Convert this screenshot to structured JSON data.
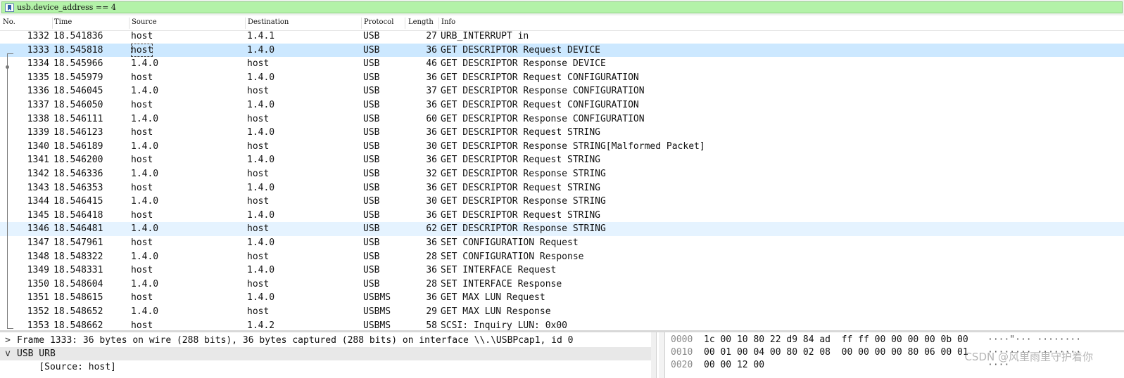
{
  "filter": {
    "text": "usb.device_address == 4",
    "accent": "#b3f2a8"
  },
  "columns": {
    "no": "No.",
    "time": "Time",
    "source": "Source",
    "destination": "Destination",
    "protocol": "Protocol",
    "length": "Length",
    "info": "Info"
  },
  "packets": [
    {
      "no": "1332",
      "time": "18.541836",
      "src": "host",
      "dst": "1.4.1",
      "proto": "USB",
      "len": "27",
      "info": "URB_INTERRUPT in"
    },
    {
      "no": "1333",
      "time": "18.545818",
      "src": "host",
      "dst": "1.4.0",
      "proto": "USB",
      "len": "36",
      "info": "GET DESCRIPTOR Request DEVICE"
    },
    {
      "no": "1334",
      "time": "18.545966",
      "src": "1.4.0",
      "dst": "host",
      "proto": "USB",
      "len": "46",
      "info": "GET DESCRIPTOR Response DEVICE"
    },
    {
      "no": "1335",
      "time": "18.545979",
      "src": "host",
      "dst": "1.4.0",
      "proto": "USB",
      "len": "36",
      "info": "GET DESCRIPTOR Request CONFIGURATION"
    },
    {
      "no": "1336",
      "time": "18.546045",
      "src": "1.4.0",
      "dst": "host",
      "proto": "USB",
      "len": "37",
      "info": "GET DESCRIPTOR Response CONFIGURATION"
    },
    {
      "no": "1337",
      "time": "18.546050",
      "src": "host",
      "dst": "1.4.0",
      "proto": "USB",
      "len": "36",
      "info": "GET DESCRIPTOR Request CONFIGURATION"
    },
    {
      "no": "1338",
      "time": "18.546111",
      "src": "1.4.0",
      "dst": "host",
      "proto": "USB",
      "len": "60",
      "info": "GET DESCRIPTOR Response CONFIGURATION"
    },
    {
      "no": "1339",
      "time": "18.546123",
      "src": "host",
      "dst": "1.4.0",
      "proto": "USB",
      "len": "36",
      "info": "GET DESCRIPTOR Request STRING"
    },
    {
      "no": "1340",
      "time": "18.546189",
      "src": "1.4.0",
      "dst": "host",
      "proto": "USB",
      "len": "30",
      "info": "GET DESCRIPTOR Response STRING[Malformed Packet]"
    },
    {
      "no": "1341",
      "time": "18.546200",
      "src": "host",
      "dst": "1.4.0",
      "proto": "USB",
      "len": "36",
      "info": "GET DESCRIPTOR Request STRING"
    },
    {
      "no": "1342",
      "time": "18.546336",
      "src": "1.4.0",
      "dst": "host",
      "proto": "USB",
      "len": "32",
      "info": "GET DESCRIPTOR Response STRING"
    },
    {
      "no": "1343",
      "time": "18.546353",
      "src": "host",
      "dst": "1.4.0",
      "proto": "USB",
      "len": "36",
      "info": "GET DESCRIPTOR Request STRING"
    },
    {
      "no": "1344",
      "time": "18.546415",
      "src": "1.4.0",
      "dst": "host",
      "proto": "USB",
      "len": "30",
      "info": "GET DESCRIPTOR Response STRING"
    },
    {
      "no": "1345",
      "time": "18.546418",
      "src": "host",
      "dst": "1.4.0",
      "proto": "USB",
      "len": "36",
      "info": "GET DESCRIPTOR Request STRING"
    },
    {
      "no": "1346",
      "time": "18.546481",
      "src": "1.4.0",
      "dst": "host",
      "proto": "USB",
      "len": "62",
      "info": "GET DESCRIPTOR Response STRING"
    },
    {
      "no": "1347",
      "time": "18.547961",
      "src": "host",
      "dst": "1.4.0",
      "proto": "USB",
      "len": "36",
      "info": "SET CONFIGURATION Request"
    },
    {
      "no": "1348",
      "time": "18.548322",
      "src": "1.4.0",
      "dst": "host",
      "proto": "USB",
      "len": "28",
      "info": "SET CONFIGURATION Response"
    },
    {
      "no": "1349",
      "time": "18.548331",
      "src": "host",
      "dst": "1.4.0",
      "proto": "USB",
      "len": "36",
      "info": "SET INTERFACE Request"
    },
    {
      "no": "1350",
      "time": "18.548604",
      "src": "1.4.0",
      "dst": "host",
      "proto": "USB",
      "len": "28",
      "info": "SET INTERFACE Response"
    },
    {
      "no": "1351",
      "time": "18.548615",
      "src": "host",
      "dst": "1.4.0",
      "proto": "USBMS",
      "len": "36",
      "info": "GET MAX LUN Request"
    },
    {
      "no": "1352",
      "time": "18.548652",
      "src": "1.4.0",
      "dst": "host",
      "proto": "USBMS",
      "len": "29",
      "info": "GET MAX LUN Response"
    },
    {
      "no": "1353",
      "time": "18.548662",
      "src": "host",
      "dst": "1.4.2",
      "proto": "USBMS",
      "len": "58",
      "info": "SCSI: Inquiry LUN: 0x00"
    }
  ],
  "selected_row": "1333",
  "hover_row": "1346",
  "details": [
    {
      "chevron": ">",
      "text": "Frame 1333: 36 bytes on wire (288 bits), 36 bytes captured (288 bits) on interface \\\\.\\USBPcap1, id 0"
    },
    {
      "chevron": "v",
      "text": "USB URB"
    },
    {
      "chevron": "",
      "text": "    [Source: host]"
    }
  ],
  "bytes": [
    {
      "offset": "0000",
      "hex": "1c 00 10 80 22 d9 84 ad  ff ff 00 00 00 00 0b 00",
      "ascii": "····\"··· ········"
    },
    {
      "offset": "0010",
      "hex": "00 01 00 04 00 80 02 08  00 00 00 00 80 06 00 01",
      "ascii": "········ ········"
    },
    {
      "offset": "0020",
      "hex": "00 00 12 00",
      "ascii": "····"
    }
  ],
  "watermark": "CSDN @风里雨里守护着你"
}
